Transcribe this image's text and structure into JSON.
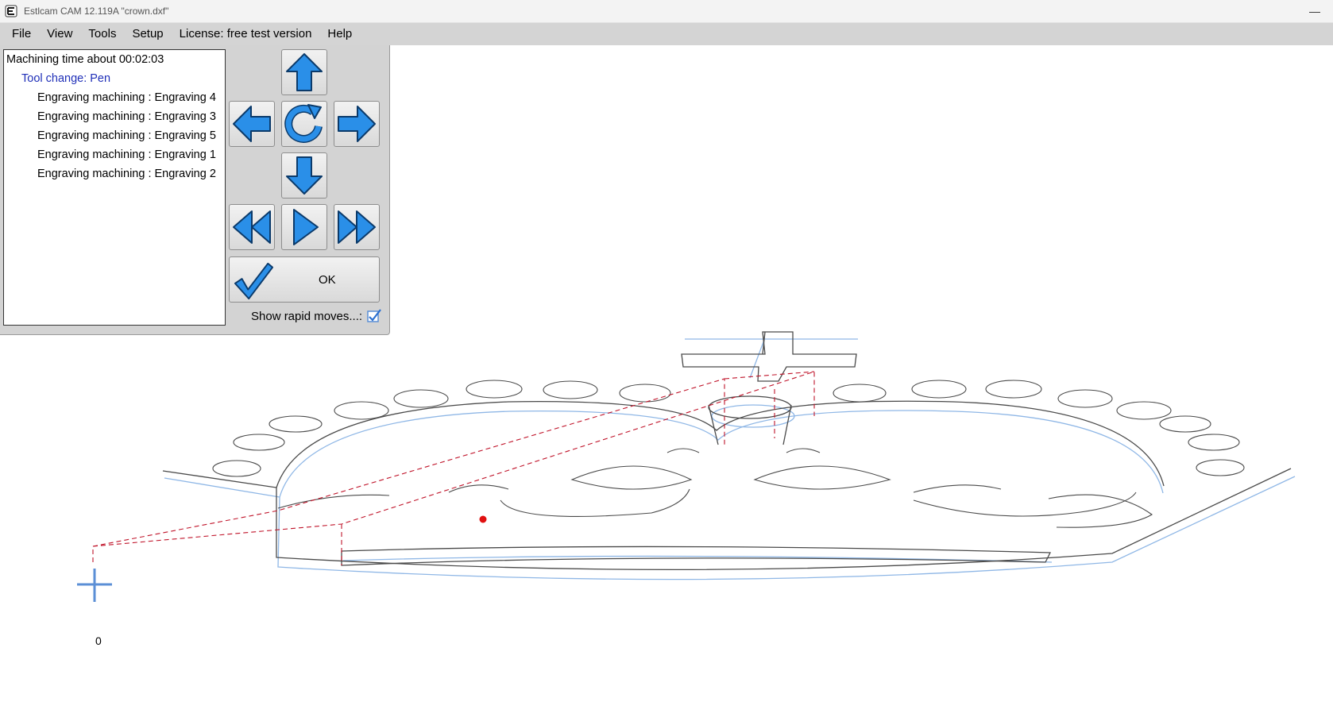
{
  "window": {
    "title": "Estlcam CAM 12.119A \"crown.dxf\"",
    "minimize_glyph": "—",
    "app_icon": "estlcam-icon"
  },
  "menu": [
    "File",
    "View",
    "Tools",
    "Setup",
    "License: free test version",
    "Help"
  ],
  "operations": {
    "time": "Machining time about 00:02:03",
    "tool_change": "Tool change: Pen",
    "items": [
      "Engraving machining : Engraving 4",
      "Engraving machining : Engraving 3",
      "Engraving machining : Engraving 5",
      "Engraving machining : Engraving 1",
      "Engraving machining : Engraving 2"
    ]
  },
  "controls": {
    "nav_icons": [
      "arrow-up-icon",
      "arrow-left-icon",
      "rotate-icon",
      "arrow-right-icon",
      "arrow-down-icon",
      "rewind-icon",
      "play-icon",
      "fast-forward-icon"
    ],
    "ok_label": "OK",
    "rapid_label": "Show rapid moves...:",
    "rapid_checked": true
  },
  "canvas": {
    "origin_label": "0"
  },
  "colors": {
    "icon_blue": "#2a8fe8",
    "icon_outline": "#0b3a6a",
    "toolpath_gray": "#4a4a4a",
    "offset_blue": "#8fb7e6",
    "rapid_red": "#c0142a",
    "origin_blue": "#5b8fd6",
    "tool_change_text": "#1f2fb8"
  }
}
